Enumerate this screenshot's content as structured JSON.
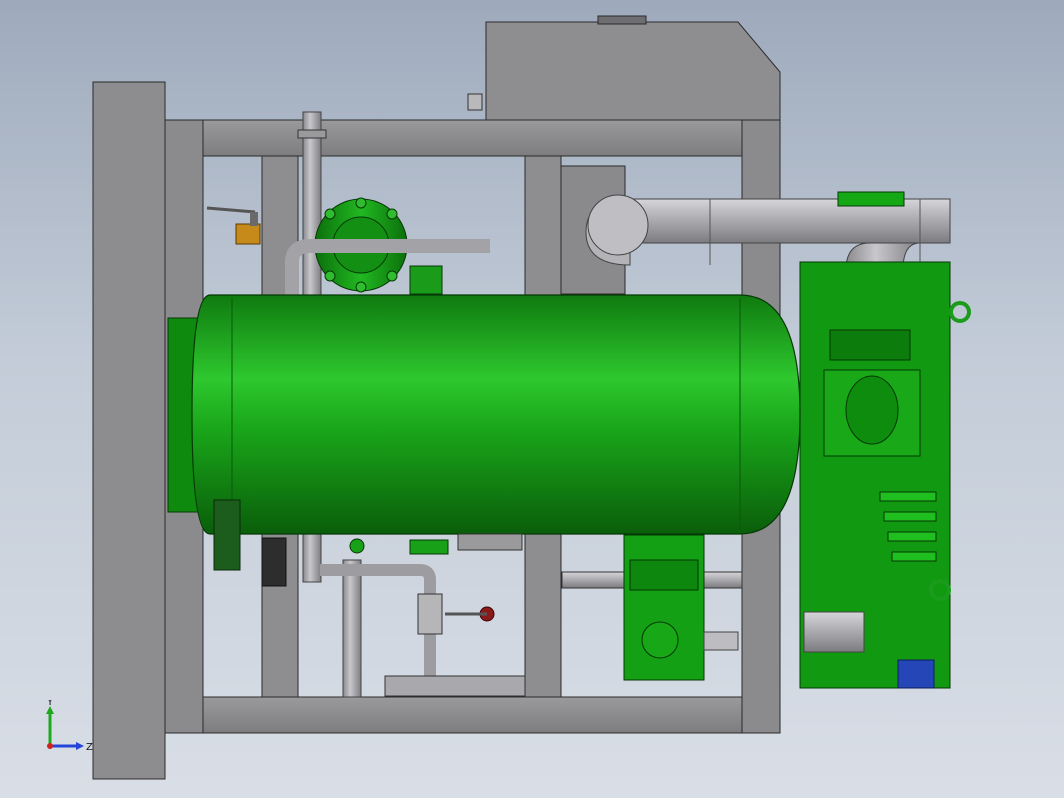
{
  "viewport": {
    "background_top": "#9eaabc",
    "background_bottom": "#d9dee6"
  },
  "model": {
    "frame_color": "#8f8f91",
    "vessel_color": "#16a216",
    "pipe_color": "#a6a6aa",
    "compressor_color": "#119a11",
    "valve_color": "#c58a1a"
  },
  "triad": {
    "y_label": "Y",
    "z_label": "Z",
    "y_axis_color": "#1ea81e",
    "z_axis_color": "#2346d8",
    "x_axis_color": "#d02020"
  }
}
